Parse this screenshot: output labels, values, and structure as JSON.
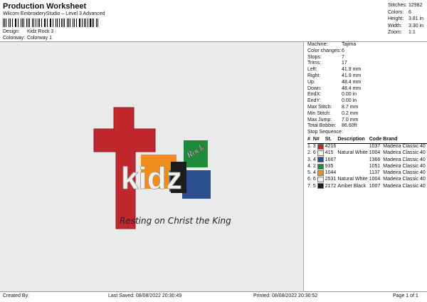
{
  "header": {
    "title": "Production Worksheet",
    "subtitle": "Wilcom EmbroideryStudio – Level 3 Advanced",
    "design_label": "Design:",
    "design_value": "Kidz Rock 3",
    "colorway_label": "Colorway:",
    "colorway_value": "Colorway 1"
  },
  "stats": [
    {
      "label": "Stitches:",
      "value": "12982"
    },
    {
      "label": "Colors:",
      "value": "6"
    },
    {
      "label": "Height:",
      "value": "3.81 in"
    },
    {
      "label": "Width:",
      "value": "3.30 in"
    },
    {
      "label": "Zoom:",
      "value": "1:1"
    }
  ],
  "machine_info": [
    {
      "label": "Machine:",
      "value": "Tajima"
    },
    {
      "label": "Color changes:",
      "value": "6"
    },
    {
      "label": "Stops:",
      "value": "7"
    },
    {
      "label": "Trims:",
      "value": "17"
    },
    {
      "label": "Left:",
      "value": "41.9 mm"
    },
    {
      "label": "Right:",
      "value": "41.9 mm"
    },
    {
      "label": "Up:",
      "value": "48.4 mm"
    },
    {
      "label": "Down:",
      "value": "48.4 mm"
    },
    {
      "label": "EndX:",
      "value": "0.00 in"
    },
    {
      "label": "EndY:",
      "value": "0.00 in"
    },
    {
      "label": "Max Stitch:",
      "value": "8.7 mm"
    },
    {
      "label": "Min Stitch:",
      "value": "0.2 mm"
    },
    {
      "label": "Max Jump:",
      "value": "7.0 mm"
    },
    {
      "label": "Total Bobbin:",
      "value": "86.60ft"
    }
  ],
  "sequence": {
    "title": "Stop Sequence:",
    "headers": [
      "#",
      "N#",
      "St.",
      "Description",
      "Code",
      "Brand"
    ],
    "rows": [
      {
        "num": "1.",
        "n": "3",
        "color": "#c0282e",
        "st": "4216",
        "desc": "",
        "code": "1037",
        "brand": "Madeira Classic 40"
      },
      {
        "num": "2.",
        "n": "6",
        "color": "#f4f1ea",
        "st": "415",
        "desc": "Natural White",
        "code": "1004",
        "brand": "Madeira Classic 40"
      },
      {
        "num": "3.",
        "n": "4",
        "color": "#2b4f8e",
        "st": "1667",
        "desc": "",
        "code": "1366",
        "brand": "Madeira Classic 40"
      },
      {
        "num": "4.",
        "n": "2",
        "color": "#1f8a3c",
        "st": "935",
        "desc": "",
        "code": "1051",
        "brand": "Madeira Classic 40"
      },
      {
        "num": "5.",
        "n": "4",
        "color": "#f08c1c",
        "st": "1044",
        "desc": "",
        "code": "1137",
        "brand": "Madeira Classic 40"
      },
      {
        "num": "6.",
        "n": "6",
        "color": "#f4f1ea",
        "st": "2531",
        "desc": "Natural White",
        "code": "1004",
        "brand": "Madeira Classic 40"
      },
      {
        "num": "7.",
        "n": "5",
        "color": "#1c1c1c",
        "st": "2172",
        "desc": "Amber Black",
        "code": "1007",
        "brand": "Madeira Classic 40"
      }
    ]
  },
  "design": {
    "logo_word": "kidz",
    "logo_small": "Rock",
    "tagline": "Resting on Christ the King"
  },
  "footer": {
    "created": "Created By:",
    "saved": "Last Saved: 08/08/2022 20:30:49",
    "printed": "Printed: 08/08/2022 20:30:52",
    "page": "Page 1 of 1"
  }
}
